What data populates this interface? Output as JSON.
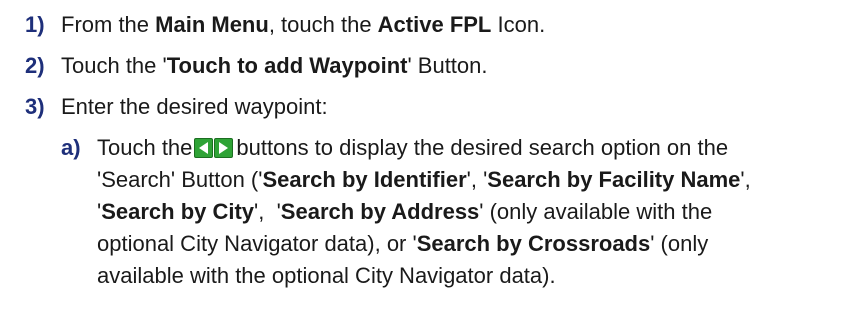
{
  "steps": [
    {
      "num": "1)",
      "pre": "From the ",
      "b1": "Main Menu",
      "mid": ", touch the ",
      "b2": "Active FPL",
      "post": " Icon."
    },
    {
      "num": "2)",
      "pre": "Touch the '",
      "b1": "Touch to add Waypoint",
      "post": "' Button."
    },
    {
      "num": "3)",
      "text": "Enter the desired waypoint:"
    }
  ],
  "substep": {
    "label": "a)",
    "t1": "Touch the",
    "t2": "buttons to display the desired search option on the",
    "t3": "'Search' Button ('",
    "opt1": "Search by Identifier",
    "t4": "', '",
    "opt2": "Search by Facility Name",
    "t5": "',",
    "t6": "'",
    "opt3": "Search by City",
    "t7": "',  '",
    "opt4": "Search by Address",
    "t8": "' (only available with the",
    "t9": "optional City Navigator data), or '",
    "opt5": "Search by Crossroads",
    "t10": "' (only",
    "t11": "available with the optional City Navigator data)."
  },
  "icons": [
    "left-arrow-icon",
    "right-arrow-icon"
  ],
  "colors": {
    "number": "#1e2f7a",
    "arrow_button": "#2fa336"
  }
}
